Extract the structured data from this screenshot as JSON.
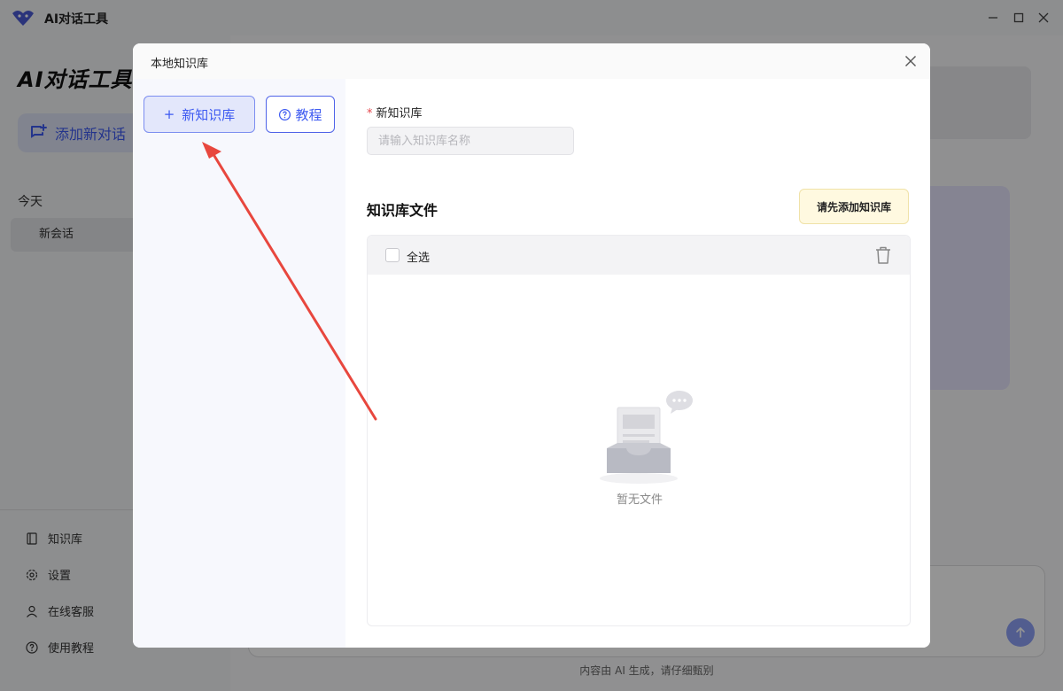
{
  "window": {
    "title": "AI对话工具",
    "minimize_icon": "minimize-icon",
    "maximize_icon": "maximize-icon",
    "close_icon": "close-icon"
  },
  "sidebar": {
    "brand": "AI对话工具",
    "new_chat_label": "添加新对话",
    "section_today": "今天",
    "conversations": [
      "新会话"
    ],
    "links": [
      {
        "label": "知识库",
        "icon": "book-icon"
      },
      {
        "label": "设置",
        "icon": "gear-icon"
      },
      {
        "label": "在线客服",
        "icon": "user-icon"
      },
      {
        "label": "使用教程",
        "icon": "help-icon"
      }
    ]
  },
  "main": {
    "footer_note": "内容由 AI 生成，请仔细甄别"
  },
  "modal": {
    "title": "本地知识库",
    "new_kb_button": "新知识库",
    "tutorial_button": "教程",
    "field_label": "新知识库",
    "field_required_mark": "*",
    "input_placeholder": "请输入知识库名称",
    "input_value": "",
    "files_title": "知识库文件",
    "add_first_button": "请先添加知识库",
    "select_all": "全选",
    "empty_text": "暂无文件"
  },
  "colors": {
    "accent": "#3d5af1",
    "arrow": "#e8473e",
    "warning_bg": "#fff9e0"
  }
}
